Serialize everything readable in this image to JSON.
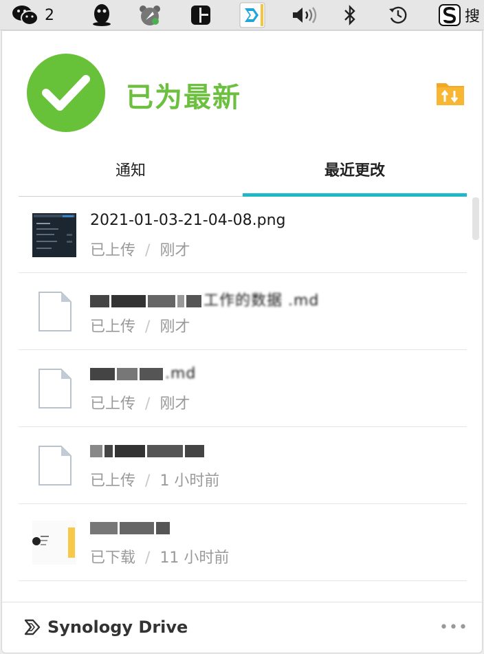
{
  "menubar": {
    "wechat_count": "2",
    "search_label": "搜"
  },
  "status": {
    "text": "已为最新",
    "accent": "#6cbf3f"
  },
  "tabs": [
    {
      "label": "通知",
      "active": false
    },
    {
      "label": "最近更改",
      "active": true
    }
  ],
  "files": [
    {
      "name": "2021-01-03-21-04-08.png",
      "action": "已上传",
      "sep": "/",
      "time": "刚才",
      "thumb": "screenshot-thumb"
    },
    {
      "name": "工作的数据 .md",
      "action": "已上传",
      "sep": "/",
      "time": "刚才",
      "thumb": "file-icon"
    },
    {
      "name": ".md",
      "action": "已上传",
      "sep": "/",
      "time": "刚才",
      "thumb": "file-icon"
    },
    {
      "name": "",
      "action": "已上传",
      "sep": "/",
      "time": "1 小时前",
      "thumb": "file-icon"
    },
    {
      "name": "",
      "action": "已下载",
      "sep": "/",
      "time": "11 小时前",
      "thumb": "image-thumb"
    }
  ],
  "footer": {
    "brand": "Synology Drive",
    "more": "•••"
  },
  "colors": {
    "tab_indicator": "#1fb8c6",
    "folder_icon": "#f5a623"
  }
}
